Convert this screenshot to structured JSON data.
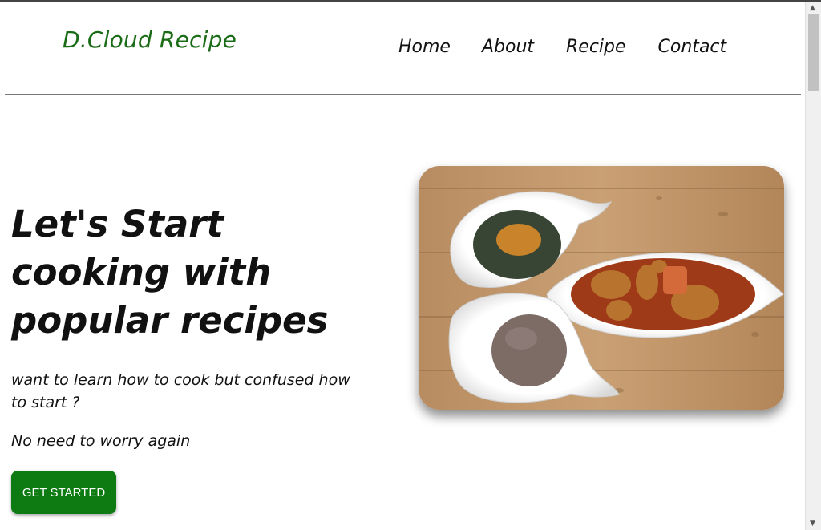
{
  "brand": "D.Cloud Recipe",
  "nav": {
    "home": "Home",
    "about": "About",
    "recipe": "Recipe",
    "contact": "Contact"
  },
  "hero": {
    "title": "Let's Start cooking with popular recipes",
    "subtitle": "want to learn how to cook but confused how to start ?",
    "note": "No need to worry again",
    "cta": "GET STARTED"
  },
  "colors": {
    "brand": "#1a6b16",
    "cta": "#0e7a12"
  },
  "scrollbar": {
    "up_icon": "▲",
    "down_icon": "▼"
  }
}
